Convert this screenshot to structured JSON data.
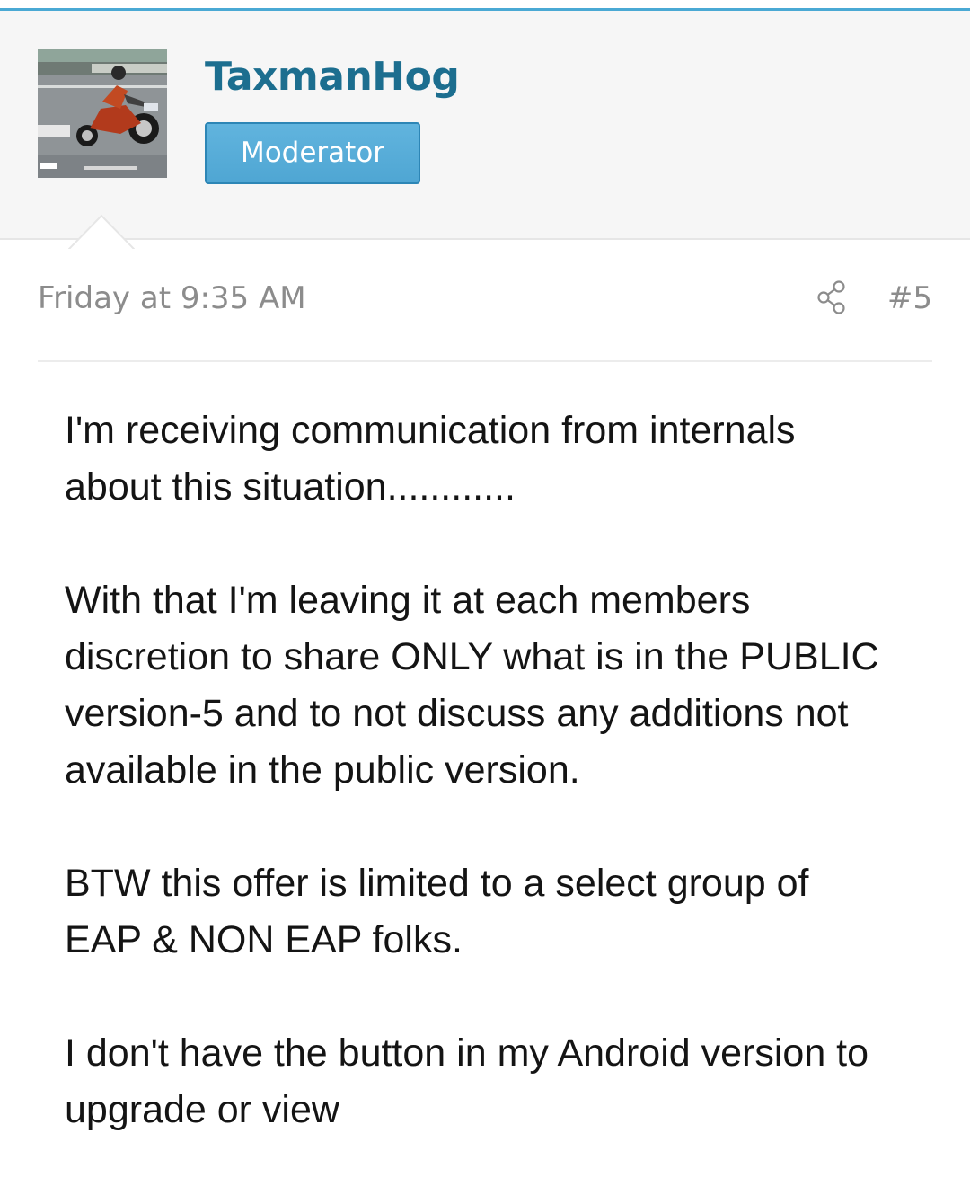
{
  "post": {
    "author": "TaxmanHog",
    "role": "Moderator",
    "date": "Friday at 9:35 AM",
    "number": "#5",
    "paragraphs": [
      "I'm receiving communication from internals\nabout this situation............",
      "With that I'm leaving it at each members\ndiscretion to share ONLY what is in the PUBLIC\nversion-5 and to not discuss any additions not\navailable in the public version.",
      "BTW this offer is limited to a select group of\nEAP & NON EAP folks.",
      "I don't have the button in my Android version to\nupgrade or view"
    ]
  },
  "icons": {
    "share": "share-icon"
  },
  "colors": {
    "accent_line": "#4aa9d4",
    "username": "#1c6e8f",
    "badge": "#55aad6",
    "meta_text": "#8c8c8c",
    "body_text": "#141414"
  }
}
